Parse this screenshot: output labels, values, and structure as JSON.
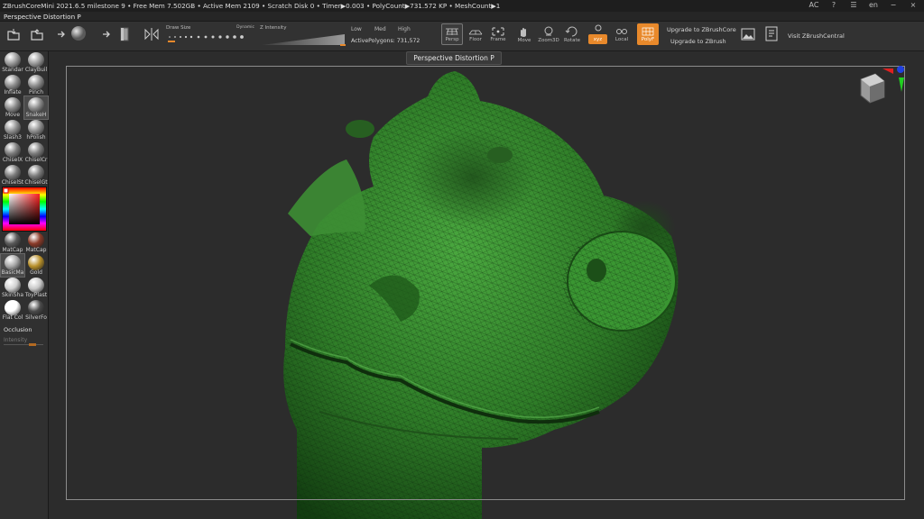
{
  "titlebar": {
    "text": "ZBrushCoreMini 2021.6.5    milestone 9  •  Free Mem 7.502GB  •  Active Mem 2109  •  Scratch Disk 0  •  Timer▶0.003  •  PolyCount▶731.572 KP  •  MeshCount▶1",
    "lang": "en",
    "ac": "AC"
  },
  "subtitle": "Perspective Distortion P",
  "shelf": {
    "draw_size_label": "Draw Size",
    "dynamic_label": "Dynamic",
    "z_intensity_label": "Z Intensity",
    "low": "Low",
    "med": "Med",
    "high": "High",
    "active_polygons": "ActivePolygons: 731,572",
    "persp": "Persp",
    "floor": "Floor",
    "frame": "Frame",
    "move": "Move",
    "zoom3d": "Zoom3D",
    "rotate": "Rotate",
    "xyz": "xyz",
    "local": "Local",
    "polyf": "PolyF",
    "upgrade_core": "Upgrade to ZBrushCore",
    "upgrade_zbrush": "Upgrade to ZBrush",
    "visit": "Visit ZBrushCentral"
  },
  "tooltip": "Perspective Distortion  P",
  "tools": [
    {
      "label": "Standar",
      "color": "#9a9a9a"
    },
    {
      "label": "ClayBuil",
      "color": "#9a9a9a"
    },
    {
      "label": "Inflate",
      "color": "#8c8c8c"
    },
    {
      "label": "Pinch",
      "color": "#8c8c8c"
    },
    {
      "label": "Move",
      "color": "#8a8a8a"
    },
    {
      "label": "SnakeH",
      "color": "#8a8a8a"
    },
    {
      "label": "Slash3",
      "color": "#8f8f8f"
    },
    {
      "label": "hPolish",
      "color": "#8f8f8f"
    },
    {
      "label": "ChiselX",
      "color": "#7d7d7d"
    },
    {
      "label": "ChiselCr",
      "color": "#7d7d7d"
    },
    {
      "label": "ChiselSt",
      "color": "#7a7a7a"
    },
    {
      "label": "ChiselGt",
      "color": "#7a7a7a"
    }
  ],
  "materials": [
    {
      "label": "MatCap",
      "color": "#5a5a5a"
    },
    {
      "label": "MatCap",
      "color": "#8a3a28"
    },
    {
      "label": "BasicMa",
      "color": "#a8a8a8"
    },
    {
      "label": "Gold",
      "color": "#b8902a"
    },
    {
      "label": "SkinSha",
      "color": "#d0d0d0"
    },
    {
      "label": "ToyPlast",
      "color": "#c8c8c8"
    },
    {
      "label": "Flat Col",
      "color": "#ffffff"
    },
    {
      "label": "SilverFo",
      "color": "#4a4a4a"
    }
  ],
  "occlusion": "Occlusion",
  "intensity": "Intensity",
  "colors": {
    "accent": "#e8892b",
    "model": "#2f7a2a"
  }
}
